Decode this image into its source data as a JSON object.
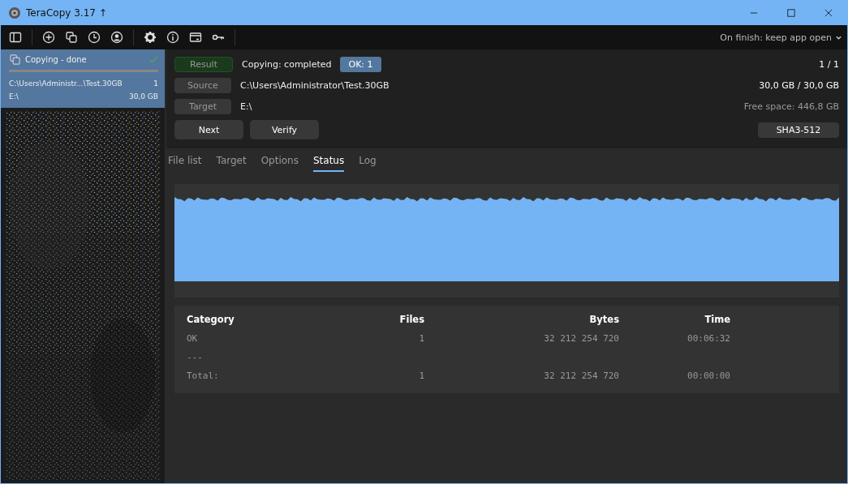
{
  "window": {
    "title": "TeraCopy 3.17 ↑"
  },
  "toolbar": {
    "on_finish": "On finish: keep app open"
  },
  "jobs": [
    {
      "title": "Copying - done",
      "done": true,
      "selected": true,
      "level": 1,
      "source": "C:\\Users\\Administr...\\Test.30GB",
      "count": "1",
      "target": "E:\\",
      "size": "30,0 GB"
    }
  ],
  "summary": {
    "result_label": "Result",
    "status": "Copying: completed",
    "ok_badge": "OK: 1",
    "progress": "1 / 1",
    "source_label": "Source",
    "source": "C:\\Users\\Administrator\\Test.30GB",
    "size": "30,0 GB / 30,0 GB",
    "target_label": "Target",
    "target": "E:\\",
    "free_space": "Free space: 446,8 GB"
  },
  "buttons": [
    "Next",
    "Verify"
  ],
  "hash_button": "SHA3-512",
  "tabs": [
    {
      "label": "File list",
      "selected": false
    },
    {
      "label": "Target",
      "selected": false
    },
    {
      "label": "Options",
      "selected": false
    },
    {
      "label": "Status",
      "selected": true
    },
    {
      "label": "Log",
      "selected": false
    }
  ],
  "table": {
    "columns": [
      "Category",
      "Files",
      "Bytes",
      "Time"
    ],
    "rows": [
      [
        "OK",
        "1",
        "32 212 254 720",
        "00:06:32"
      ],
      [
        "---",
        "",
        "",
        ""
      ],
      [
        "Total:",
        "1",
        "32 212 254 720",
        "00:00:00"
      ]
    ]
  }
}
